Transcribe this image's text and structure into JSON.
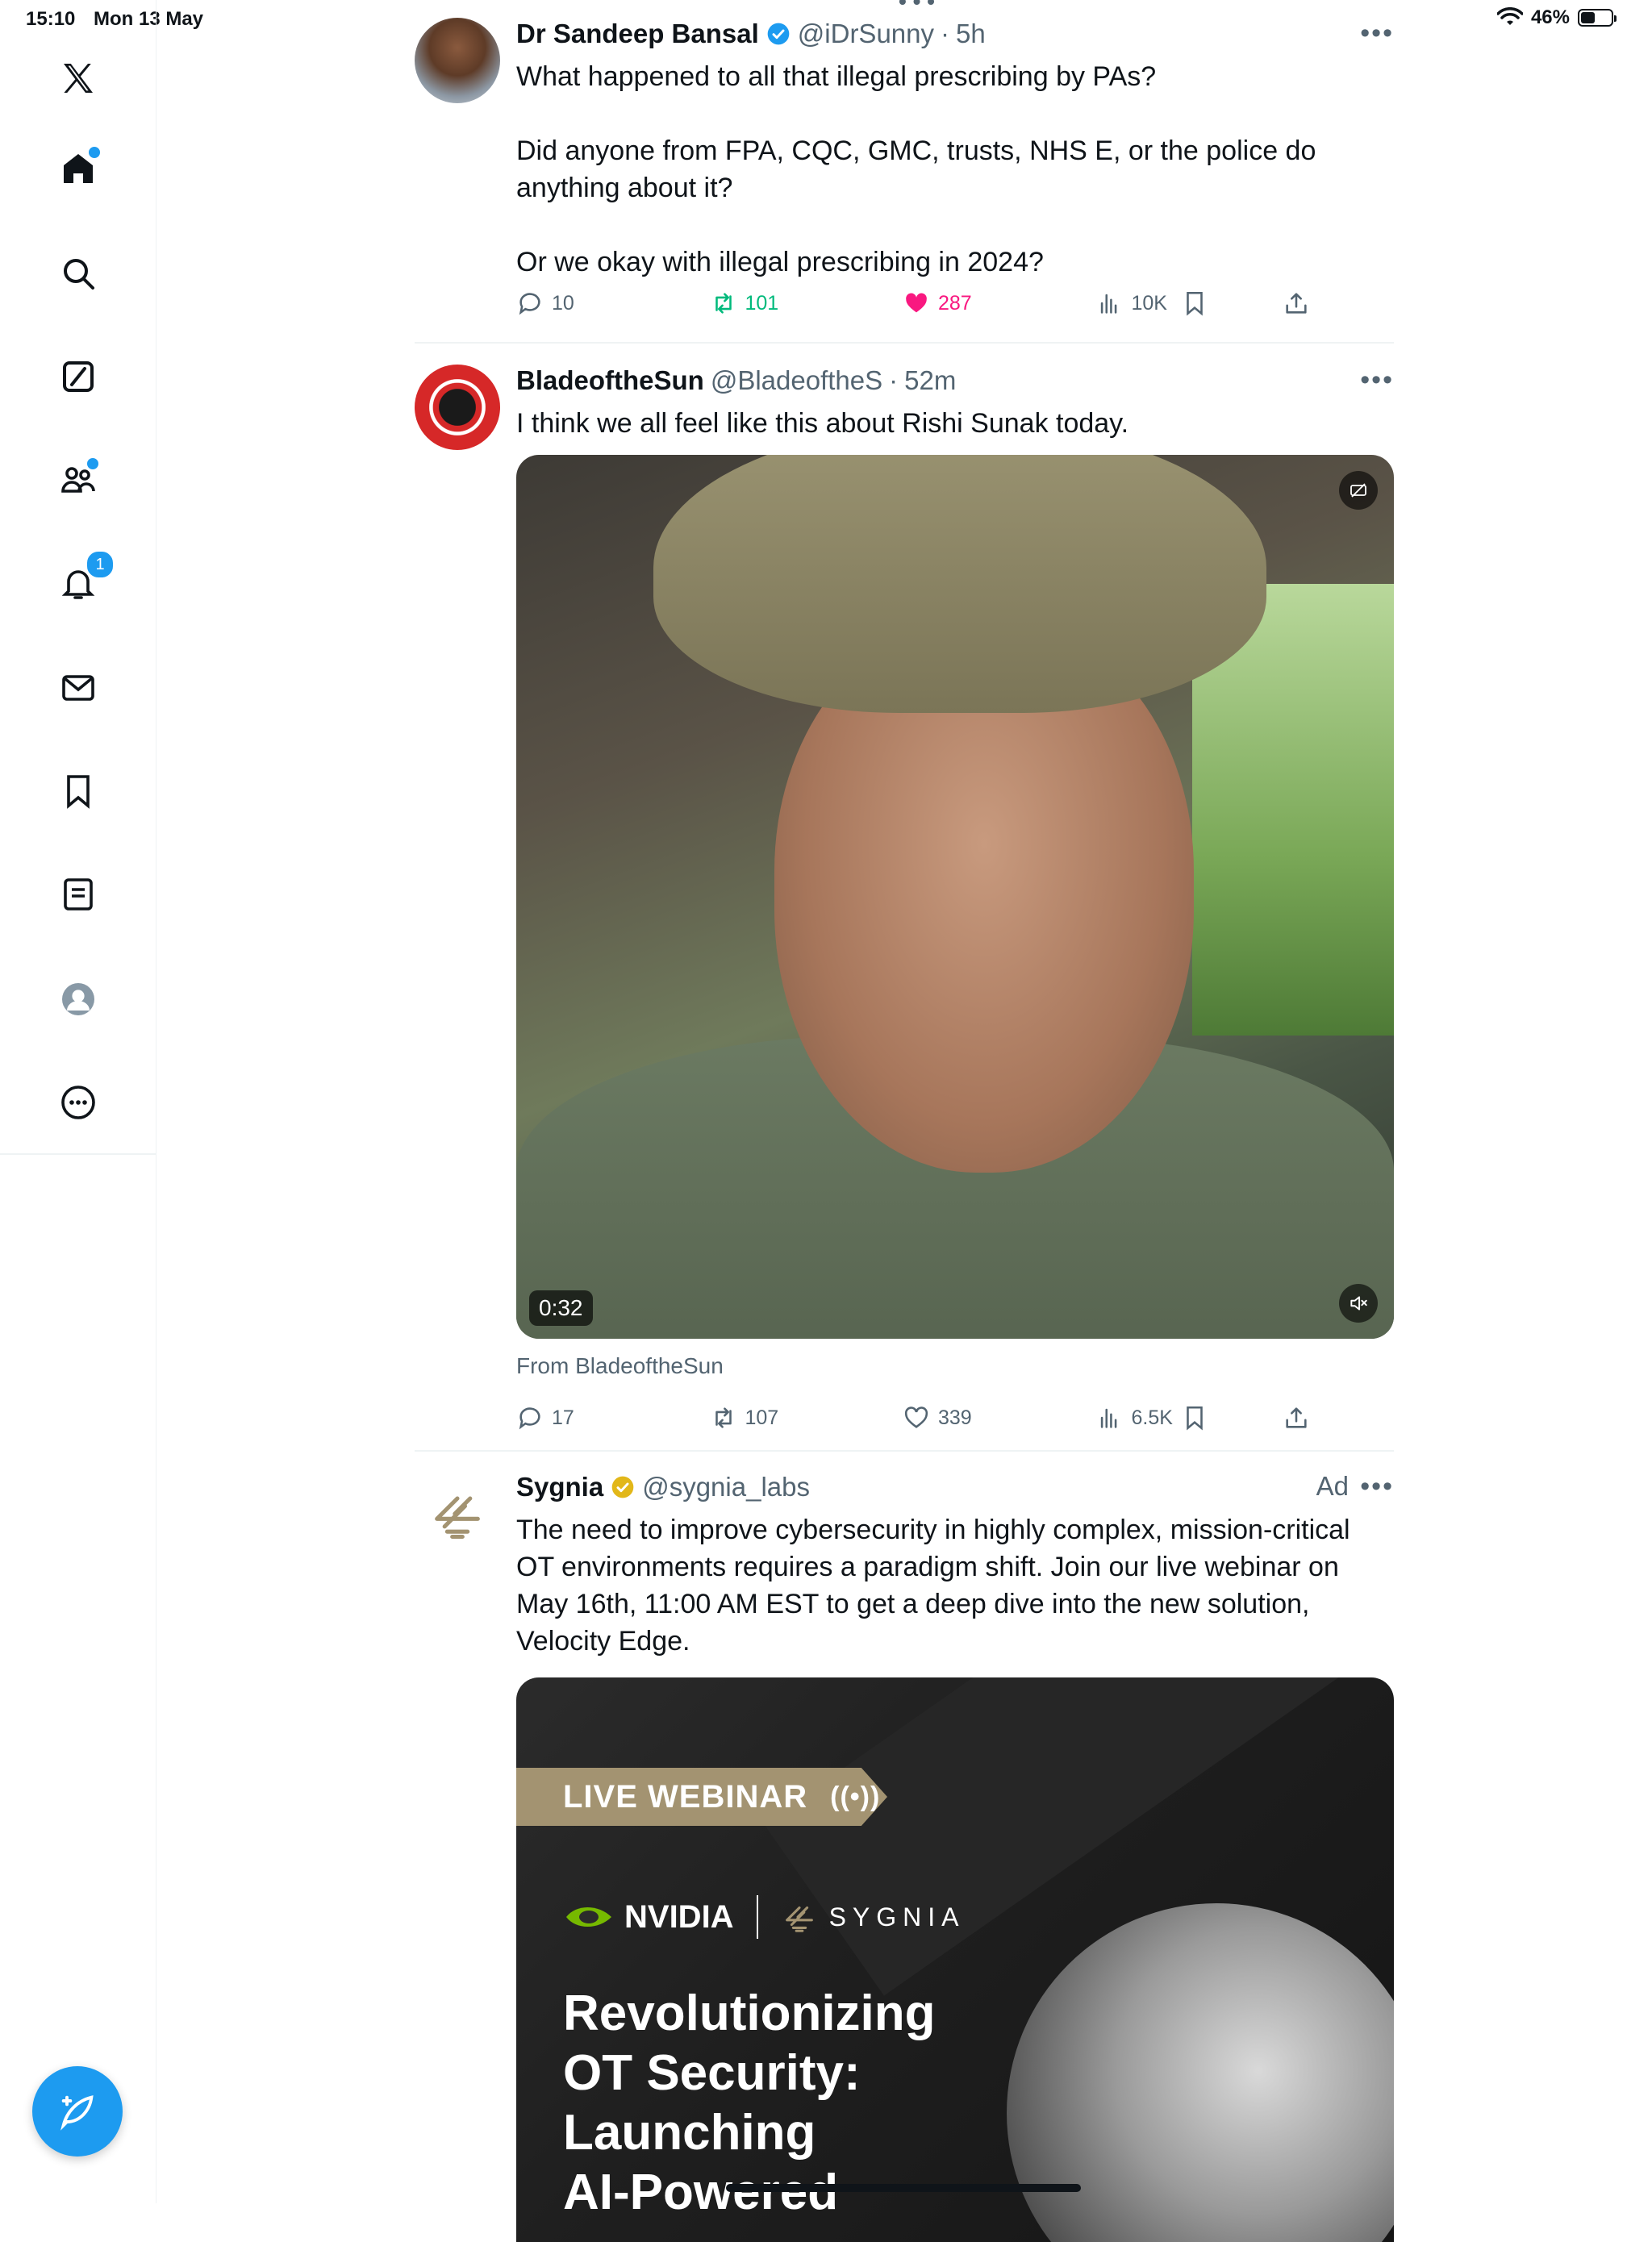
{
  "status_bar": {
    "time": "15:10",
    "date": "Mon 13 May",
    "battery_percent": "46%",
    "battery_level": 0.46
  },
  "sidebar": {
    "items": [
      {
        "name": "x-logo-icon"
      },
      {
        "name": "home-icon",
        "has_dot": true
      },
      {
        "name": "search-icon"
      },
      {
        "name": "grok-icon"
      },
      {
        "name": "communities-icon",
        "has_dot": true
      },
      {
        "name": "notifications-icon",
        "badge": "1"
      },
      {
        "name": "messages-icon"
      },
      {
        "name": "bookmarks-icon"
      },
      {
        "name": "lists-icon"
      },
      {
        "name": "profile-icon"
      },
      {
        "name": "more-icon"
      }
    ],
    "compose_icon": "compose-icon"
  },
  "colors": {
    "accent": "#1d9bf0",
    "retweet": "#00ba7c",
    "like": "#f91880",
    "muted": "#536471"
  },
  "tweets": [
    {
      "name": "Dr Sandeep Bansal",
      "handle": "@iDrSunny",
      "sep": "·",
      "age": "5h",
      "verified": true,
      "text": "What happened to all that illegal prescribing by PAs?\n\nDid anyone from FPA, CQC, GMC, trusts, NHS E, or the police do anything about it?\n\nOr we okay with illegal prescribing in 2024?",
      "replies": "10",
      "reposts": "101",
      "likes": "287",
      "views": "10K",
      "liked": true,
      "reposted": true
    },
    {
      "name": "BladeoftheSun",
      "handle": "@BladeoftheS",
      "sep": "·",
      "age": "52m",
      "text": "I think we all feel like this about Rishi Sunak today.",
      "video_duration": "0:32",
      "from_label": "From BladeoftheSun",
      "replies": "17",
      "reposts": "107",
      "likes": "339",
      "views": "6.5K"
    },
    {
      "name": "Sygnia",
      "handle": "@sygnia_labs",
      "ad_label": "Ad",
      "verified_gold": true,
      "text": "The need to improve cybersecurity in highly complex, mission-critical OT environments requires a paradigm shift. Join our live webinar on May 16th, 11:00 AM EST to get a deep dive into the new solution, Velocity Edge.",
      "card": {
        "banner": "LIVE WEBINAR",
        "radio_glyph": "((•))",
        "nvidia": "NVIDIA",
        "sygnia": "SYGNIA",
        "headline": "Revolutionizing\nOT Security:\nLaunching\nAI-Powered"
      }
    }
  ]
}
